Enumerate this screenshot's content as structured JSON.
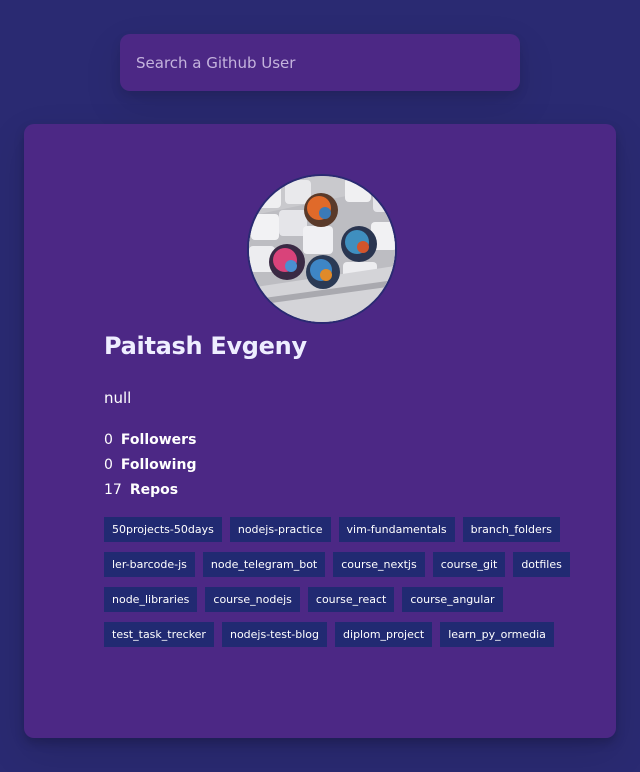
{
  "search": {
    "placeholder": "Search a Github User",
    "value": ""
  },
  "profile": {
    "avatar_icon": "avatar-photo-keyboard-keycaps",
    "name": "Paitash Evgeny",
    "bio": "null",
    "stats": [
      {
        "count": "0",
        "label": "Followers"
      },
      {
        "count": "0",
        "label": "Following"
      },
      {
        "count": "17",
        "label": "Repos"
      }
    ],
    "repos": [
      "50projects-50days",
      "nodejs-practice",
      "vim-fundamentals",
      "branch_folders",
      "ler-barcode-js",
      "node_telegram_bot",
      "course_nextjs",
      "course_git",
      "dotfiles",
      "node_libraries",
      "course_nodejs",
      "course_react",
      "course_angular",
      "test_task_trecker",
      "nodejs-test-blog",
      "diplom_project",
      "learn_py_ormedia"
    ]
  },
  "colors": {
    "background": "#2a2a72",
    "card": "#4c2885",
    "repo_tag": "#212a72",
    "text": "#ffffff"
  }
}
